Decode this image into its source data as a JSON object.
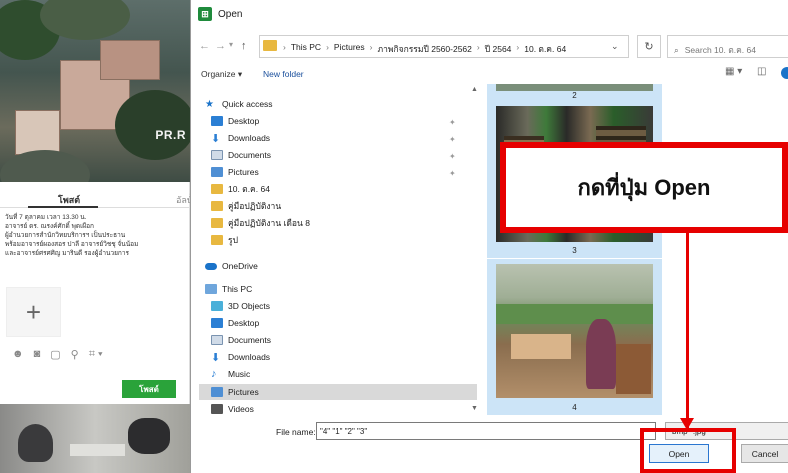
{
  "background_app": {
    "photo_watermark": "PR.R",
    "tabs": [
      "โพสต์",
      "อัลบั้ม"
    ],
    "post_text": [
      "วันที่ 7 ตุลาคม เวลา 13.30 น.",
      "อาจารย์ ดร. ณรงค์ศักดิ์ พุดเผือก",
      "ผู้อำนวยการสำนักวิทยบริการฯ เป็นประธาน",
      "พร้อมอาจารย์ผองสอร ปาลี อาจารย์วิชชุ จั่นน้อม",
      "และอาจารย์ศรศศิญ มารินดี รองผู้อำนวยการ"
    ],
    "add_symbol": "+",
    "toolbar_glyphs": [
      "☻",
      "◙",
      "▢",
      "⚲",
      "⌗ ▾"
    ],
    "post_button": "โพสต์"
  },
  "dialog": {
    "title": "Open",
    "title_icon": "green-app-icon",
    "nav": {
      "back": "←",
      "forward": "→",
      "recent": "▾",
      "up": "↑"
    },
    "breadcrumbs": [
      "This PC",
      "Pictures",
      "ภาพกิจกรรมปี 2560-2562",
      "ปี 2564",
      "10. ต.ค. 64"
    ],
    "breadcrumb_separator": "›",
    "address_dropdown": "⌄",
    "refresh": "↻",
    "search_placeholder": "Search 10. ต.ค. 64",
    "command_bar": {
      "organize": "Organize ▾",
      "new_folder": "New folder",
      "view": "▦ ▾",
      "pane": "◫"
    },
    "nav_pane": {
      "quick_access": "Quick access",
      "quick_items": [
        "Desktop",
        "Downloads",
        "Documents",
        "Pictures",
        "10. ต.ค. 64",
        "คู่มือปฏิบัติงาน",
        "คู่มือปฏิบัติงาน เดือน 8",
        "รูป"
      ],
      "onedrive": "OneDrive",
      "this_pc": "This PC",
      "pc_items": [
        "3D Objects",
        "Desktop",
        "Documents",
        "Downloads",
        "Music",
        "Pictures",
        "Videos"
      ],
      "pin_glyph": "📌"
    },
    "thumbnails": [
      {
        "label": "2"
      },
      {
        "label": "3"
      },
      {
        "label": "4"
      }
    ],
    "file_name_label": "File name:",
    "file_name_value": "\"4\" \"1\" \"2\" \"3\"",
    "file_type_value": "bmp *.jpg *",
    "open_button": "Open",
    "cancel_button": "Cancel"
  },
  "annotation": {
    "callout_text": "กดที่ปุ่ม Open",
    "color": "#e60000"
  }
}
